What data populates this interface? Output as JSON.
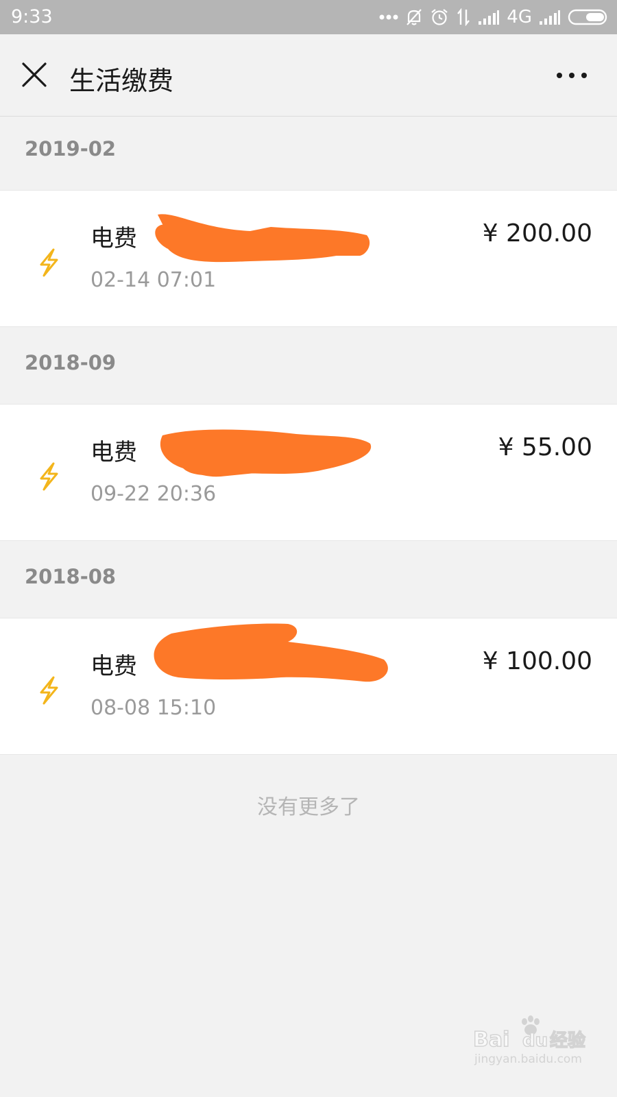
{
  "status_bar": {
    "time": "9:33",
    "network": "4G"
  },
  "header": {
    "title": "生活缴费"
  },
  "groups": [
    {
      "month": "2019-02",
      "items": [
        {
          "title": "电费",
          "time": "02-14 07:01",
          "amount": "¥ 200.00",
          "icon": "lightning-icon"
        }
      ]
    },
    {
      "month": "2018-09",
      "items": [
        {
          "title": "电费",
          "time": "09-22 20:36",
          "amount": "¥ 55.00",
          "icon": "lightning-icon"
        }
      ]
    },
    {
      "month": "2018-08",
      "items": [
        {
          "title": "电费",
          "time": "08-08 15:10",
          "amount": "¥ 100.00",
          "icon": "lightning-icon"
        }
      ]
    }
  ],
  "footer": {
    "no_more": "没有更多了"
  },
  "watermark": {
    "brand": "Bai du 经验",
    "url": "jingyan.baidu.com"
  },
  "colors": {
    "status_bar_bg": "#b5b5b5",
    "page_bg": "#f2f2f2",
    "card_bg": "#ffffff",
    "bolt_icon": "#f3b51b",
    "redaction": "#fd7828"
  }
}
